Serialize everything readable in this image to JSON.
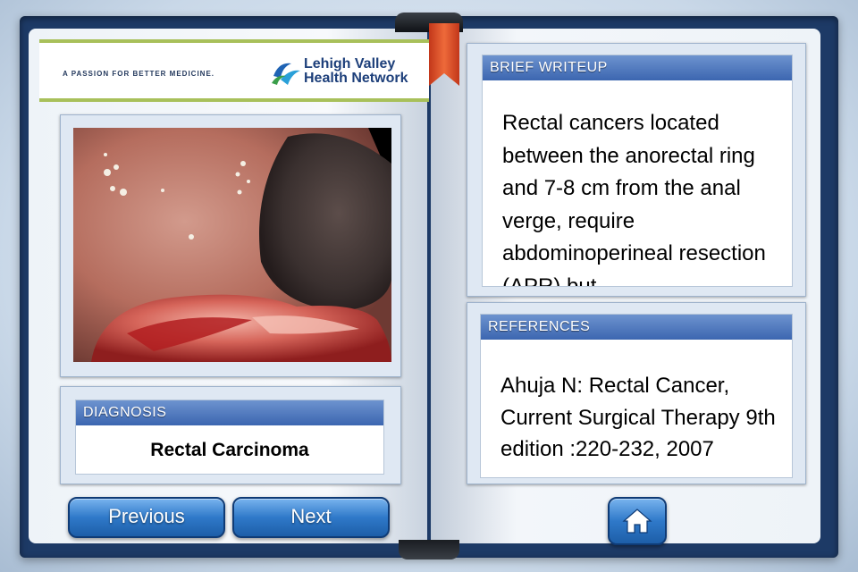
{
  "header": {
    "tagline": "A PASSION FOR BETTER MEDICINE.",
    "logo_line1": "Lehigh Valley",
    "logo_line2": "Health Network"
  },
  "image": {
    "icon": "endoscopy-photo"
  },
  "diagnosis": {
    "title": "DIAGNOSIS",
    "value": "Rectal Carcinoma"
  },
  "brief": {
    "title": "BRIEF WRITEUP",
    "text": "Rectal cancers located between the anorectal ring and 7-8 cm from the anal verge, require abdominoperineal resection (APR) but"
  },
  "references": {
    "title": "REFERENCES",
    "text": "Ahuja N: Rectal Cancer, Current Surgical Therapy 9th edition :220-232, 2007"
  },
  "nav": {
    "previous_label": "Previous",
    "next_label": "Next",
    "home_icon": "home-icon"
  },
  "colors": {
    "frame": "#1d3a66",
    "title_bar": "#3c66b0",
    "button": "#2f79c9",
    "bookmark": "#e0552a",
    "accent_green": "#a8c05a"
  }
}
